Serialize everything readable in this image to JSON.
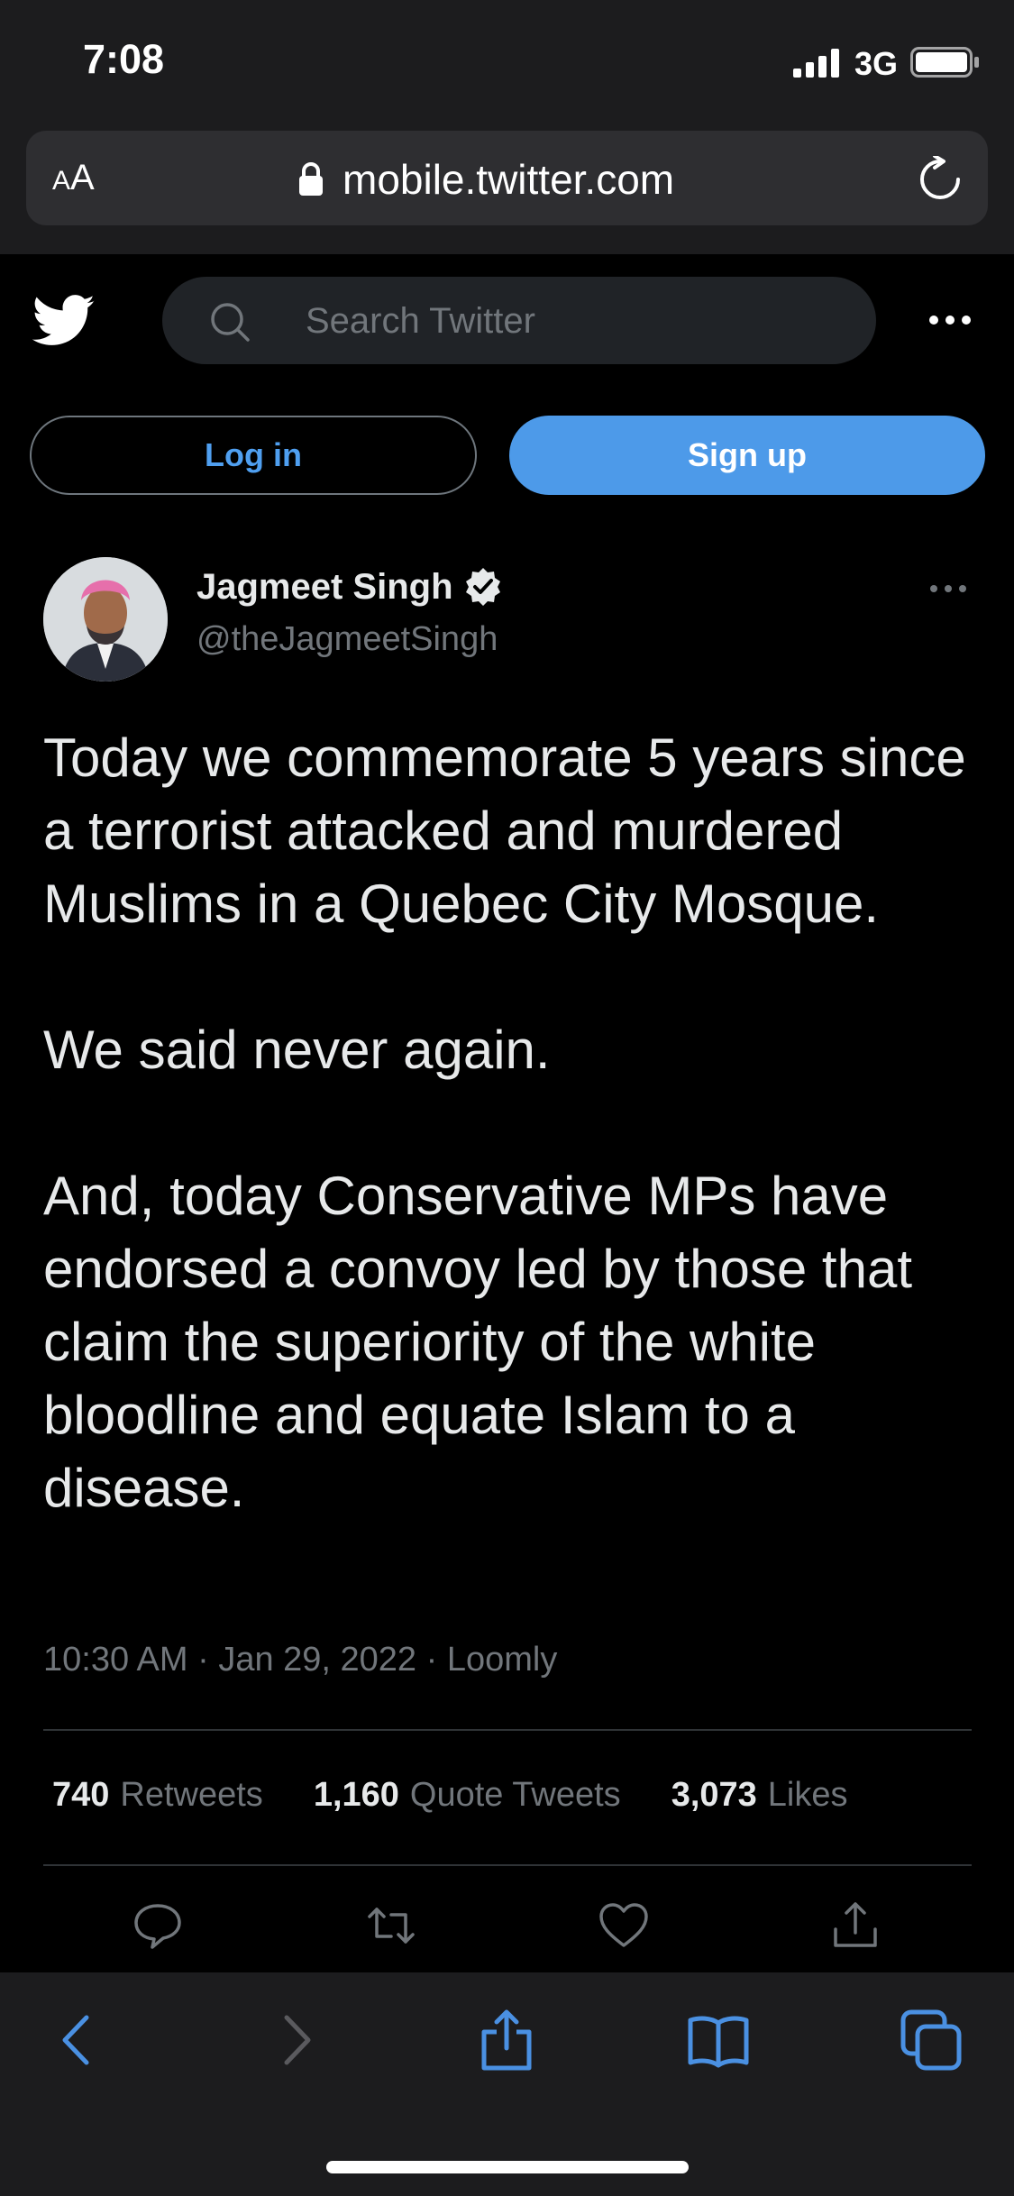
{
  "status": {
    "time": "7:08",
    "network": "3G"
  },
  "browser": {
    "aa_small": "A",
    "aa_large": "A",
    "url": "mobile.twitter.com"
  },
  "header": {
    "search_placeholder": "Search Twitter",
    "login_label": "Log in",
    "signup_label": "Sign up"
  },
  "tweet": {
    "name": "Jagmeet Singh",
    "handle": "@theJagmeetSingh",
    "text": "Today we commemorate 5 years since a terrorist attacked and murdered Muslims in a Quebec City Mosque.\n\nWe said never again.\n\nAnd, today Conservative MPs have endorsed a convoy led by those that claim the superiority of the white bloodline and equate Islam to a disease.",
    "meta": "10:30 AM · Jan 29, 2022 · Loomly",
    "stats": [
      {
        "num": "740",
        "label": "Retweets"
      },
      {
        "num": "1,160",
        "label": "Quote Tweets"
      },
      {
        "num": "3,073",
        "label": "Likes"
      }
    ]
  },
  "colors": {
    "accent": "#4d9ae9",
    "link": "#4f9ff0",
    "background": "#000000",
    "secondary_text": "#71767b"
  },
  "icons": [
    "signal-icon",
    "battery-icon",
    "lock-icon",
    "reload-icon",
    "twitter-logo-icon",
    "search-icon",
    "more-icon",
    "verified-icon",
    "reply-icon",
    "retweet-icon",
    "like-icon",
    "share-icon",
    "back-icon",
    "forward-icon",
    "share-sheet-icon",
    "bookmarks-icon",
    "tabs-icon"
  ]
}
